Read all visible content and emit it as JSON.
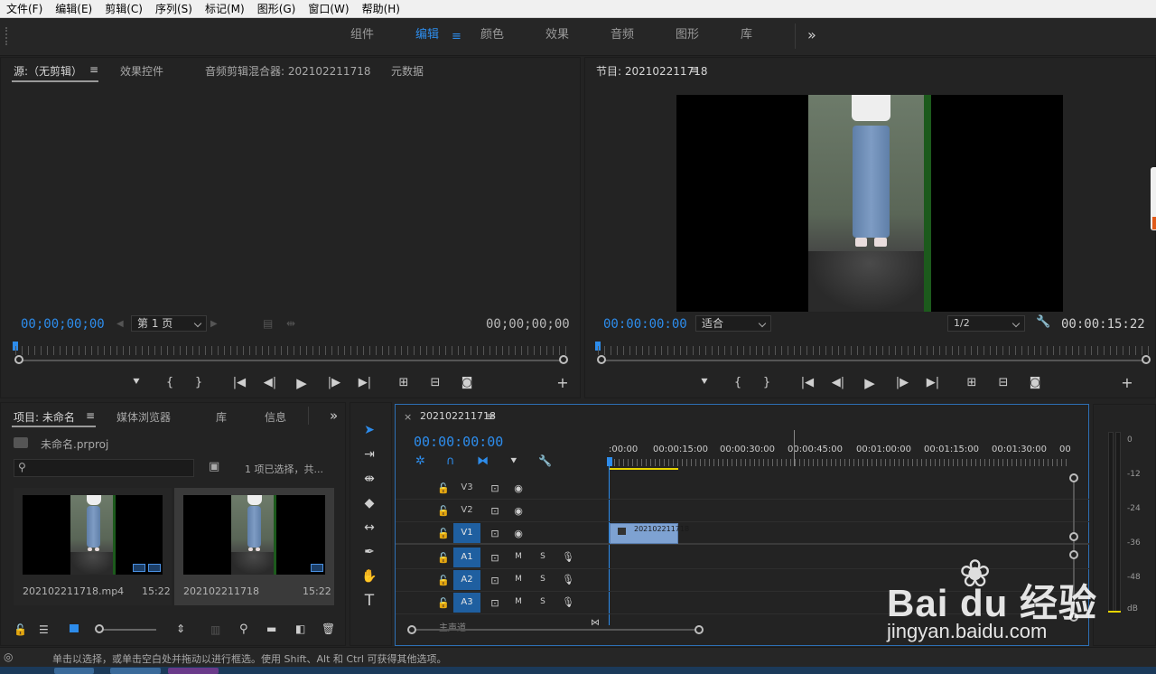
{
  "menu": [
    "文件(F)",
    "编辑(E)",
    "剪辑(C)",
    "序列(S)",
    "标记(M)",
    "图形(G)",
    "窗口(W)",
    "帮助(H)"
  ],
  "workspaces": {
    "items": [
      "组件",
      "编辑",
      "颜色",
      "效果",
      "音频",
      "图形",
      "库"
    ],
    "active_index": 1,
    "more": "»"
  },
  "source_panel": {
    "tabs": [
      "源:（无剪辑）",
      "效果控件",
      "音频剪辑混合器: 202102211718",
      "元数据"
    ],
    "timecode_left": "00;00;00;00",
    "page_select": "第 1 页",
    "timecode_right": "00;00;00;00"
  },
  "program_panel": {
    "title": "节目: 202102211718",
    "timecode_left": "00:00:00:00",
    "fit_select": "适合",
    "resolution_select": "1/2",
    "timecode_right": "00:00:15:22"
  },
  "project_panel": {
    "tabs": [
      "项目: 未命名",
      "媒体浏览器",
      "库",
      "信息"
    ],
    "more": "»",
    "file": "未命名.prproj",
    "selection_info": "1 项已选择，共...",
    "items": [
      {
        "name": "202102211718.mp4",
        "duration": "15:22"
      },
      {
        "name": "202102211718",
        "duration": "15:22"
      }
    ]
  },
  "timeline": {
    "close": "×",
    "sequence_name": "202102211718",
    "timecode": "00:00:00:00",
    "ruler_labels": [
      ":00:00",
      "00:00:15:00",
      "00:00:30:00",
      "00:00:45:00",
      "00:01:00:00",
      "00:01:15:00",
      "00:01:30:00",
      "00"
    ],
    "video_tracks": [
      "V3",
      "V2",
      "V1"
    ],
    "audio_tracks": [
      "A1",
      "A2",
      "A3"
    ],
    "audio_buttons": {
      "mute": "M",
      "solo": "S"
    },
    "clip_name": "202102211718",
    "master_label": "主声道"
  },
  "meter_scale": [
    "0",
    "-12",
    "-24",
    "-36",
    "-48",
    "dB"
  ],
  "status_text": "单击以选择，或单击空白处并拖动以进行框选。使用 Shift、Alt 和 Ctrl 可获得其他选项。",
  "watermark": {
    "brand": "Bai du 经验",
    "url": "jingyan.baidu.com"
  },
  "colors": {
    "accent": "#2d8ceb",
    "track_active": "#1f5fa0",
    "clip": "#7ea2d2",
    "work_area": "#e6d400"
  }
}
